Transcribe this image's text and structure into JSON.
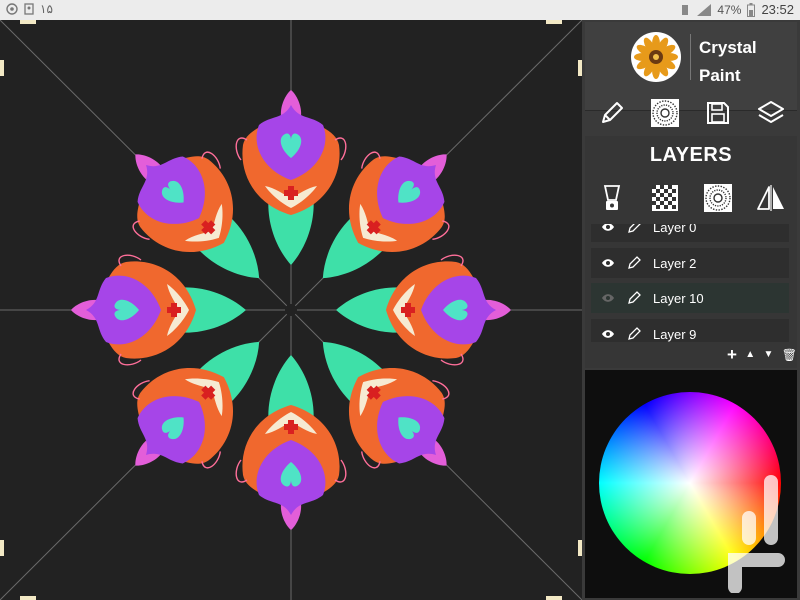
{
  "status_bar": {
    "left_icons": [
      "notification-icon",
      "image-icon"
    ],
    "left_text": "۱۵",
    "battery_percent": "47%",
    "time": "23:52"
  },
  "app": {
    "name": "Crystal\nPaint",
    "accent_color": "#ffffff"
  },
  "toolbar": {
    "tools": [
      "pencil-icon",
      "mandala-icon",
      "save-icon",
      "layers-icon"
    ]
  },
  "layers_panel": {
    "title": "LAYERS",
    "tools": [
      "blender-icon",
      "transparency-icon",
      "mandala-icon",
      "mirror-icon"
    ],
    "layers": [
      {
        "name": "Layer 0",
        "visible": true,
        "selected": false
      },
      {
        "name": "Layer 2",
        "visible": true,
        "selected": false
      },
      {
        "name": "Layer 10",
        "visible": false,
        "selected": true
      },
      {
        "name": "Layer 9",
        "visible": true,
        "selected": false
      }
    ],
    "actions": {
      "add": "+",
      "up": "▲",
      "down": "▼",
      "delete": "🗑"
    }
  },
  "colors": {
    "canvas_bg": "#222222",
    "panel_bg": "#3a3a3a",
    "selected_layer": "#2c3532"
  }
}
